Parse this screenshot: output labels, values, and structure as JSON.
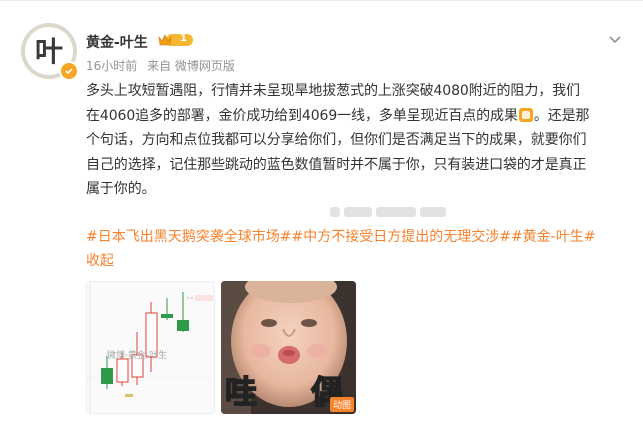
{
  "author": {
    "name": "黄金-叶生",
    "avatar_char": "叶",
    "vip_level": "1"
  },
  "meta": {
    "time": "16小时前",
    "source": "来自 微博网页版"
  },
  "content": {
    "line1": "多头上攻短暂遇阻，行情并未呈现旱地拔葱式的上涨突破4080附近的阻力，我们",
    "line2a": "在4060追多的部署，金价成功给到4069一线，多单呈现近百点的成果",
    "line2b": "。还是那",
    "line3": "个句话，方向和点位我都可以分享给你们，但你们是否满足当下的成果，就要你们",
    "line4": "自己的选择，记住那些跳动的蓝色数值暂时并不属于你，只有装进口袋的才是真正",
    "line5": "属于你的。"
  },
  "tags": {
    "tag1": "#日本飞出黑天鹅突袭全球市场#",
    "tag2": "#中方不接受日方提出的无理交涉#",
    "tag3": "#黄金-叶生#",
    "collapse": "收起"
  },
  "images": {
    "chart_watermark": "微博·黄金-叶生",
    "meme_left": "哇",
    "meme_right": "偶",
    "gif_badge": "动图"
  },
  "colors": {
    "accent": "#f6822b",
    "verify": "#f5a623",
    "candle_green": "#2e9a4a",
    "candle_red": "#e0433b"
  }
}
